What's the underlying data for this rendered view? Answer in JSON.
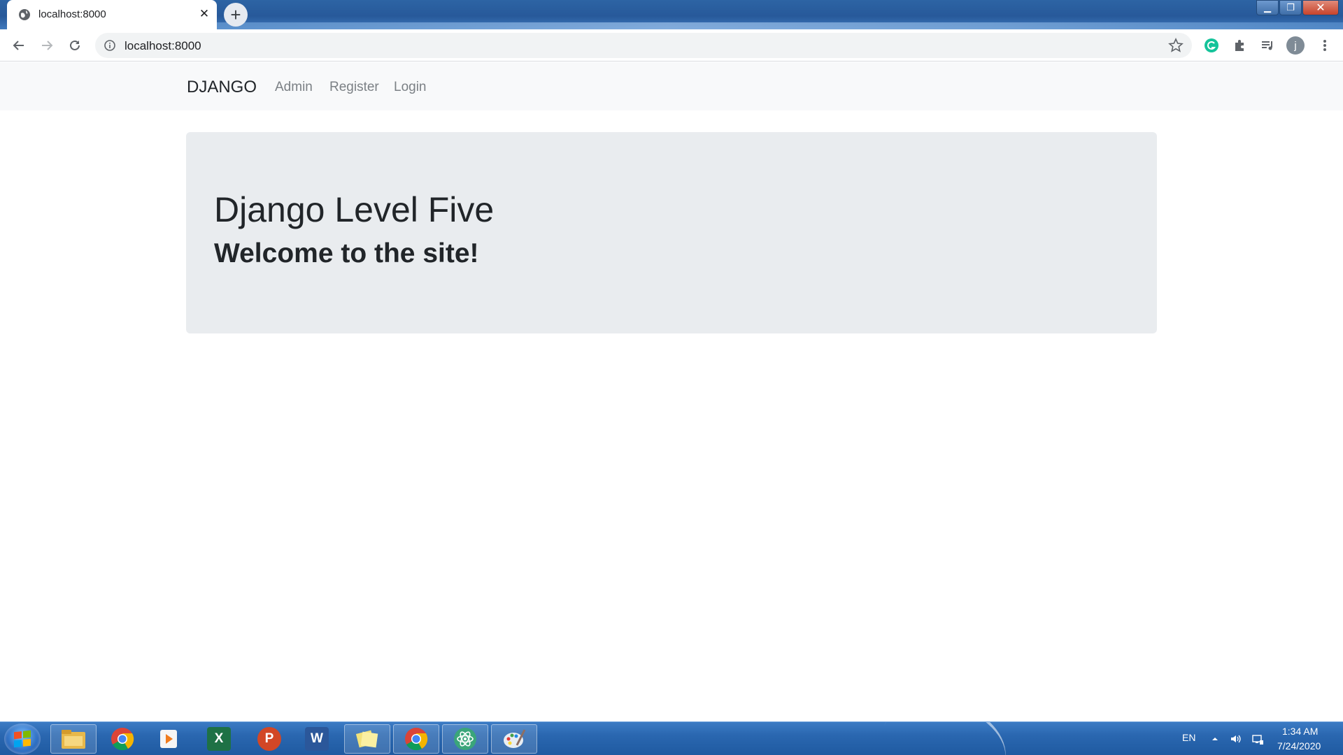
{
  "browser": {
    "tab_title": "localhost:8000",
    "url": "localhost:8000",
    "avatar_letter": "j"
  },
  "page": {
    "brand": "DJANGO",
    "nav_links": [
      "Admin",
      "Register",
      "Login"
    ],
    "jumbotron_title": "Django Level Five",
    "jumbotron_subtitle": "Welcome to the site!"
  },
  "taskbar": {
    "language": "EN",
    "time": "1:34 AM",
    "date": "7/24/2020",
    "apps": [
      "file-explorer-icon",
      "chrome-icon",
      "media-player-icon",
      "excel-icon",
      "powerpoint-icon",
      "word-icon",
      "sticky-notes-icon",
      "chrome-icon",
      "atom-icon",
      "paint-icon"
    ]
  },
  "colors": {
    "navbar_bg": "#f8f9fa",
    "jumbotron_bg": "#e9ecef",
    "nav_link": "#7b8085",
    "text_dark": "#212529"
  }
}
